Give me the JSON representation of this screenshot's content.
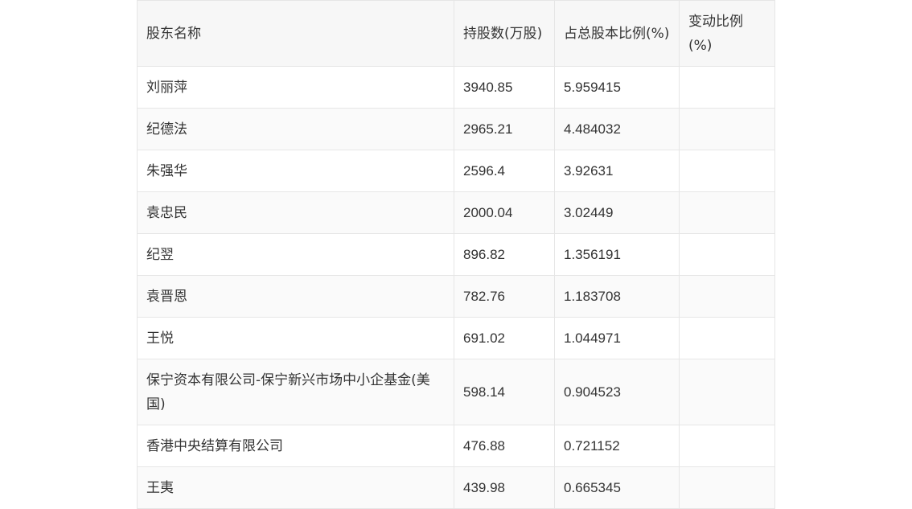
{
  "table": {
    "headers": {
      "name": "股东名称",
      "shares": "持股数(万股)",
      "ratio": "占总股本比例(%)",
      "change": "变动比例(%)"
    },
    "rows": [
      {
        "name": "刘丽萍",
        "shares": "3940.85",
        "ratio": "5.959415",
        "change": ""
      },
      {
        "name": "纪德法",
        "shares": "2965.21",
        "ratio": "4.484032",
        "change": ""
      },
      {
        "name": "朱强华",
        "shares": "2596.4",
        "ratio": "3.92631",
        "change": ""
      },
      {
        "name": "袁忠民",
        "shares": "2000.04",
        "ratio": "3.02449",
        "change": ""
      },
      {
        "name": "纪翌",
        "shares": "896.82",
        "ratio": "1.356191",
        "change": ""
      },
      {
        "name": "袁晋恩",
        "shares": "782.76",
        "ratio": "1.183708",
        "change": ""
      },
      {
        "name": "王悦",
        "shares": "691.02",
        "ratio": "1.044971",
        "change": ""
      },
      {
        "name": "保宁资本有限公司-保宁新兴市场中小企基金(美国)",
        "shares": "598.14",
        "ratio": "0.904523",
        "change": ""
      },
      {
        "name": "香港中央结算有限公司",
        "shares": "476.88",
        "ratio": "0.721152",
        "change": ""
      },
      {
        "name": "王夷",
        "shares": "439.98",
        "ratio": "0.665345",
        "change": ""
      }
    ]
  }
}
